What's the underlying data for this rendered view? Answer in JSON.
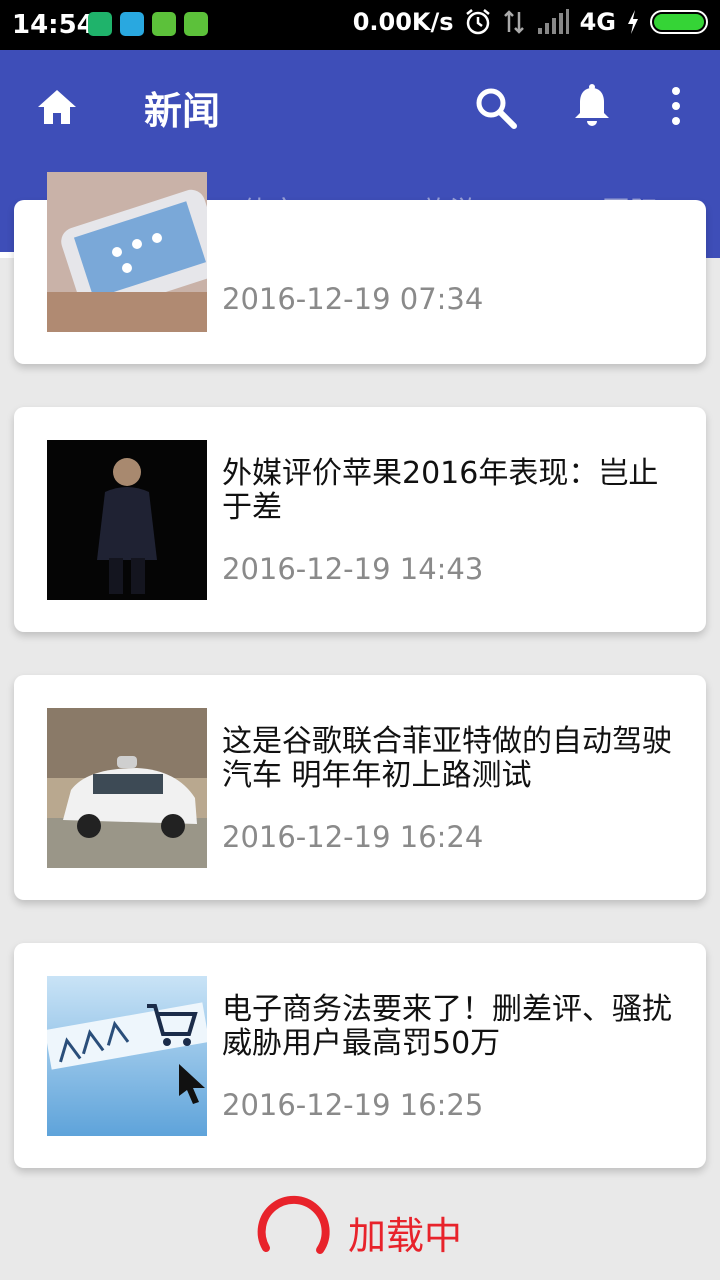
{
  "status_bar": {
    "time": "14:54",
    "net_speed": "0.00K/s",
    "network": "4G",
    "battery_color": "#35d436"
  },
  "app_bar": {
    "title": "新闻",
    "background": "#3e4eb8",
    "icons": [
      "home-icon",
      "search-icon",
      "bell-icon",
      "more-vertical-icon"
    ]
  },
  "tabs": [
    {
      "label": "科技",
      "active": true
    },
    {
      "label": "体育",
      "active": false
    },
    {
      "label": "旅游",
      "active": false
    },
    {
      "label": "国际",
      "active": false
    }
  ],
  "news": [
    {
      "title": "",
      "time": "2016-12-19 07:34"
    },
    {
      "title": "外媒评价苹果2016年表现：岂止于差",
      "time": "2016-12-19 14:43"
    },
    {
      "title": "这是谷歌联合菲亚特做的自动驾驶汽车 明年年初上路测试",
      "time": "2016-12-19 16:24"
    },
    {
      "title": "电子商务法要来了！删差评、骚扰威胁用户最高罚50万",
      "time": "2016-12-19 16:25"
    }
  ],
  "loading": {
    "text": "加载中",
    "color": "#e8232b"
  }
}
